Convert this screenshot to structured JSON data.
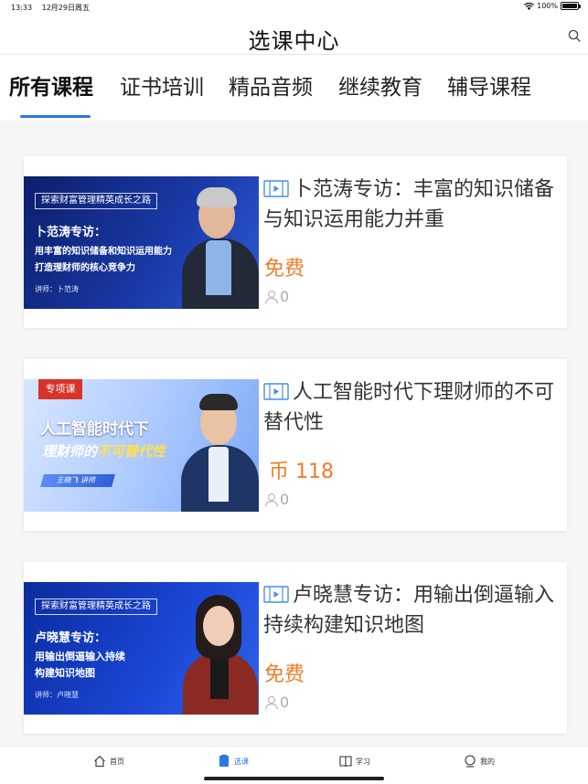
{
  "status_bar": {
    "time": "13:33",
    "date": "12月29日周五",
    "battery": "100%",
    "battery_level": 1.0
  },
  "header": {
    "title": "选课中心",
    "search_icon": "search-icon"
  },
  "category_tabs": [
    {
      "label": "所有课程",
      "active": true
    },
    {
      "label": "证书培训",
      "active": false
    },
    {
      "label": "精品音频",
      "active": false
    },
    {
      "label": "继续教育",
      "active": false
    },
    {
      "label": "辅导课程",
      "active": false
    }
  ],
  "courses": [
    {
      "title": "卜范涛专访：丰富的知识储备与知识运用能力并重",
      "price": "免费",
      "learners": "0",
      "thumbnail": {
        "banner": "探索财富管理精英成长之路",
        "headline": "卜范涛专访：",
        "line1": "用丰富的知识储备和知识运用能力",
        "line2": "打造理财师的核心竞争力",
        "lecturer": "讲师：卜范涛"
      }
    },
    {
      "title": "人工智能时代下理财师的不可替代性",
      "price": "币 118",
      "learners": "0",
      "thumbnail": {
        "badge": "专项课",
        "headline": "人工智能时代下",
        "line1_a": "理财师的",
        "line1_b": "不可替代性",
        "lecturer": "王晓飞 讲师"
      }
    },
    {
      "title": "卢晓慧专访：用输出倒逼输入持续构建知识地图",
      "price": "免费",
      "learners": "0",
      "thumbnail": {
        "banner": "探索财富管理精英成长之路",
        "headline": "卢晓慧专访：",
        "line1": "用输出倒逼输入持续",
        "line2": "构建知识地图",
        "lecturer": "讲师：卢晓慧"
      }
    }
  ],
  "bottom_tabs": [
    {
      "label": "首页",
      "icon": "home-icon",
      "active": false
    },
    {
      "label": "选课",
      "icon": "course-select-icon",
      "active": true
    },
    {
      "label": "学习",
      "icon": "book-icon",
      "active": false
    },
    {
      "label": "我的",
      "icon": "profile-icon",
      "active": false
    }
  ],
  "colors": {
    "accent": "#2b78e4",
    "price": "#f07c2a"
  }
}
